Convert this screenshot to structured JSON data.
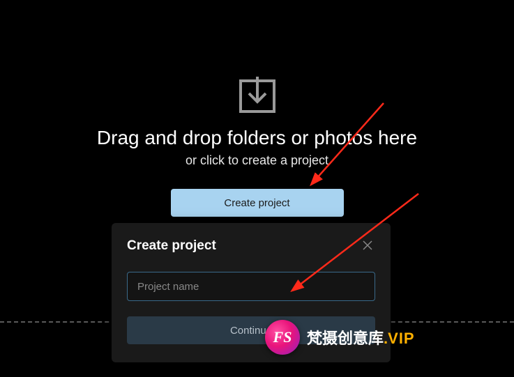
{
  "drop": {
    "headline": "Drag and drop folders or photos here",
    "subline": "or click to create a project",
    "create_button_label": "Create project"
  },
  "modal": {
    "title": "Create project",
    "name_placeholder": "Project name",
    "name_value": "",
    "continue_label": "Continue"
  },
  "watermark": {
    "badge": "FS",
    "cn": "梵摄创意库",
    "dot": ".",
    "vip": "VIP"
  },
  "colors": {
    "primary_button": "#a8d3f0",
    "input_border": "#3a6a8a",
    "arrow": "#ff2a1a"
  }
}
